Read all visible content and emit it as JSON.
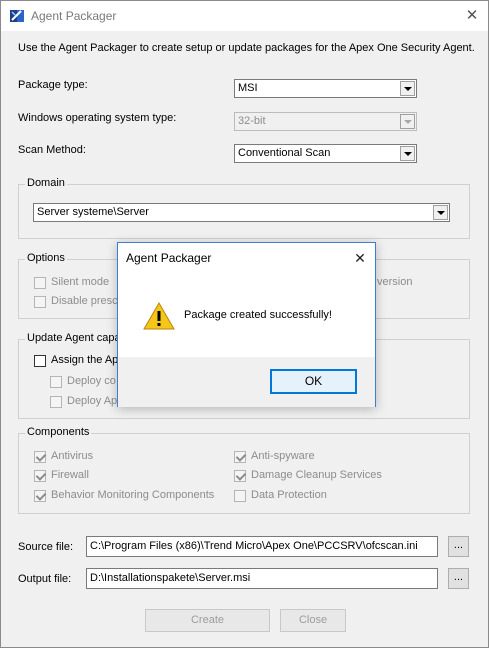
{
  "window": {
    "title": "Agent Packager",
    "close_glyph": "✕",
    "icon": "agent-packager-app-icon"
  },
  "intro_text": "Use the Agent Packager to create setup or update packages for the Apex One Security Agent.",
  "package_type": {
    "label": "Package type:",
    "value": "MSI"
  },
  "os_type": {
    "label": "Windows operating system type:",
    "value": "32-bit"
  },
  "scan_method": {
    "label": "Scan Method:",
    "value": "Conventional Scan"
  },
  "domain": {
    "group_title": "Domain",
    "value": "Server systeme\\Server"
  },
  "options": {
    "group_title": "Options",
    "silent_mode": "Silent mode",
    "disable_prescan": "Disable presca",
    "version_fragment": "version"
  },
  "update_agent": {
    "group_title": "Update Agent capa",
    "assign": "Assign the Ap",
    "deploy1": "Deploy co",
    "deploy2": "Deploy Ap"
  },
  "components": {
    "group_title": "Components",
    "items": [
      {
        "label": "Antivirus",
        "checked": true
      },
      {
        "label": "Anti-spyware",
        "checked": true
      },
      {
        "label": "Firewall",
        "checked": true
      },
      {
        "label": "Damage Cleanup Services",
        "checked": true
      },
      {
        "label": "Behavior Monitoring Components",
        "checked": true
      },
      {
        "label": "Data Protection",
        "checked": false
      }
    ]
  },
  "source_file": {
    "label": "Source file:",
    "value": "C:\\Program Files (x86)\\Trend Micro\\Apex One\\PCCSRV\\ofcscan.ini",
    "browse_label": "..."
  },
  "output_file": {
    "label": "Output file:",
    "value": "D:\\Installationspakete\\Server.msi",
    "browse_label": "..."
  },
  "buttons": {
    "create": "Create",
    "close": "Close"
  },
  "dialog": {
    "title": "Agent Packager",
    "close_glyph": "✕",
    "message": "Package created successfully!",
    "ok": "OK",
    "icon": "warning-icon"
  }
}
